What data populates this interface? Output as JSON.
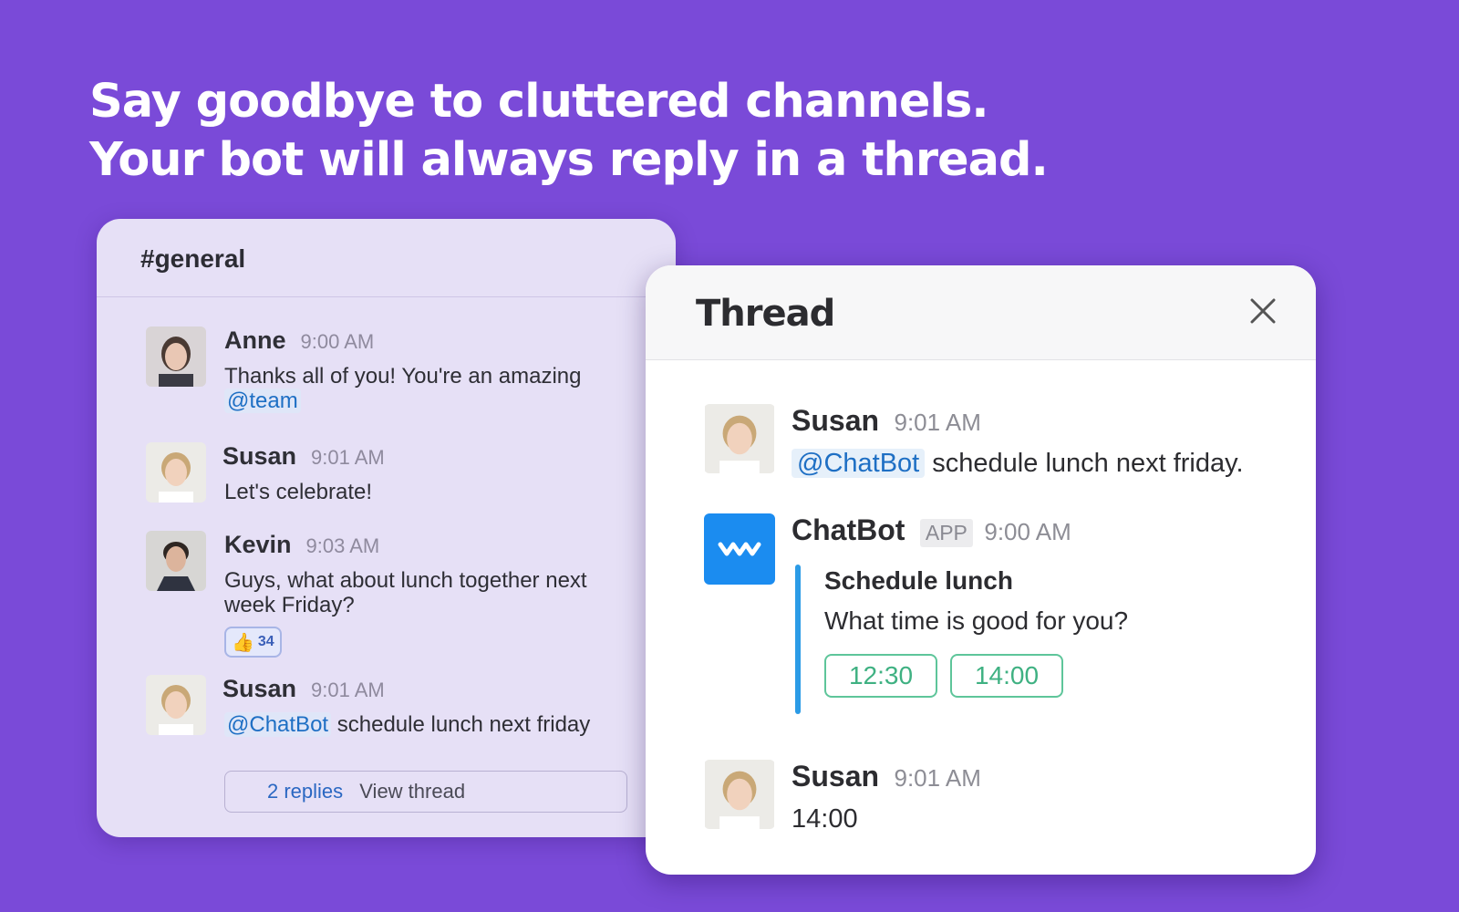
{
  "headline": {
    "line1": "Say goodbye to cluttered channels.",
    "line2": "Your bot will always reply in a thread."
  },
  "channel": {
    "name": "#general",
    "messages": [
      {
        "author": "Anne",
        "time": "9:00 AM",
        "text": "Thanks all of you! You're an amazing",
        "mention": "@team"
      },
      {
        "author": "Susan",
        "time": "9:01 AM",
        "text": "Let's celebrate!"
      },
      {
        "author": "Kevin",
        "time": "9:03 AM",
        "text": "Guys, what about lunch together next week Friday?",
        "reaction": {
          "icon": "thumbs-up-icon",
          "count": "34"
        }
      },
      {
        "author": "Susan",
        "time": "9:01 AM",
        "mention": "@ChatBot",
        "text": "schedule lunch next friday"
      }
    ],
    "replies": {
      "count": "2 replies",
      "view": "View thread"
    }
  },
  "thread": {
    "title": "Thread",
    "close_icon": "close-icon",
    "root": {
      "author": "Susan",
      "time": "9:01 AM",
      "mention": "@ChatBot",
      "text": "schedule lunch next friday."
    },
    "bot": {
      "author": "ChatBot",
      "badge": "APP",
      "time": "9:00 AM",
      "attachment": {
        "title": "Schedule lunch",
        "text": "What time is good for you?",
        "options": [
          "12:30",
          "14:00"
        ]
      }
    },
    "reply": {
      "author": "Susan",
      "time": "9:01 AM",
      "text": "14:00"
    }
  },
  "colors": {
    "background": "#7a4ad8",
    "mention": "#1e6fc4",
    "bot": "#1b8cf0",
    "choice": "#3fb182",
    "attachment_bar": "#2b9be6"
  }
}
